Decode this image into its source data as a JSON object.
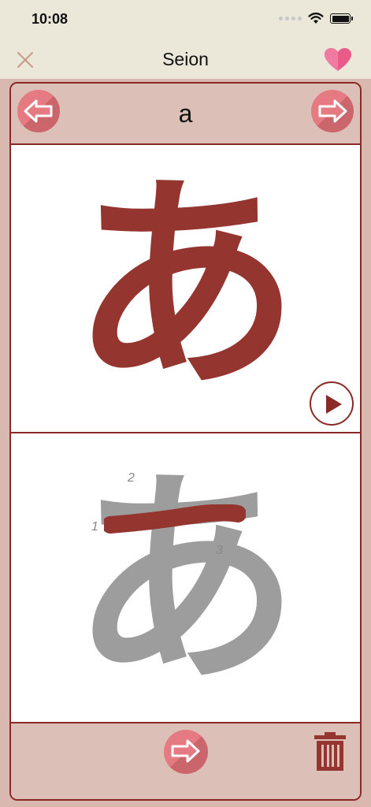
{
  "status_bar": {
    "time": "10:08"
  },
  "nav": {
    "title": "Seion"
  },
  "lesson": {
    "romaji": "a",
    "kana": "あ",
    "stroke_numbers": [
      "1",
      "2",
      "3"
    ]
  },
  "colors": {
    "accent": "#953530",
    "button_pink": "#e57a82",
    "panel_bg": "#dcc0b8",
    "bar_bg": "#ebe8da"
  },
  "icons": {
    "close": "close-icon",
    "favorite": "heart-icon",
    "previous": "arrow-left-icon",
    "next": "arrow-right-icon",
    "play": "play-icon",
    "delete": "trash-icon"
  }
}
